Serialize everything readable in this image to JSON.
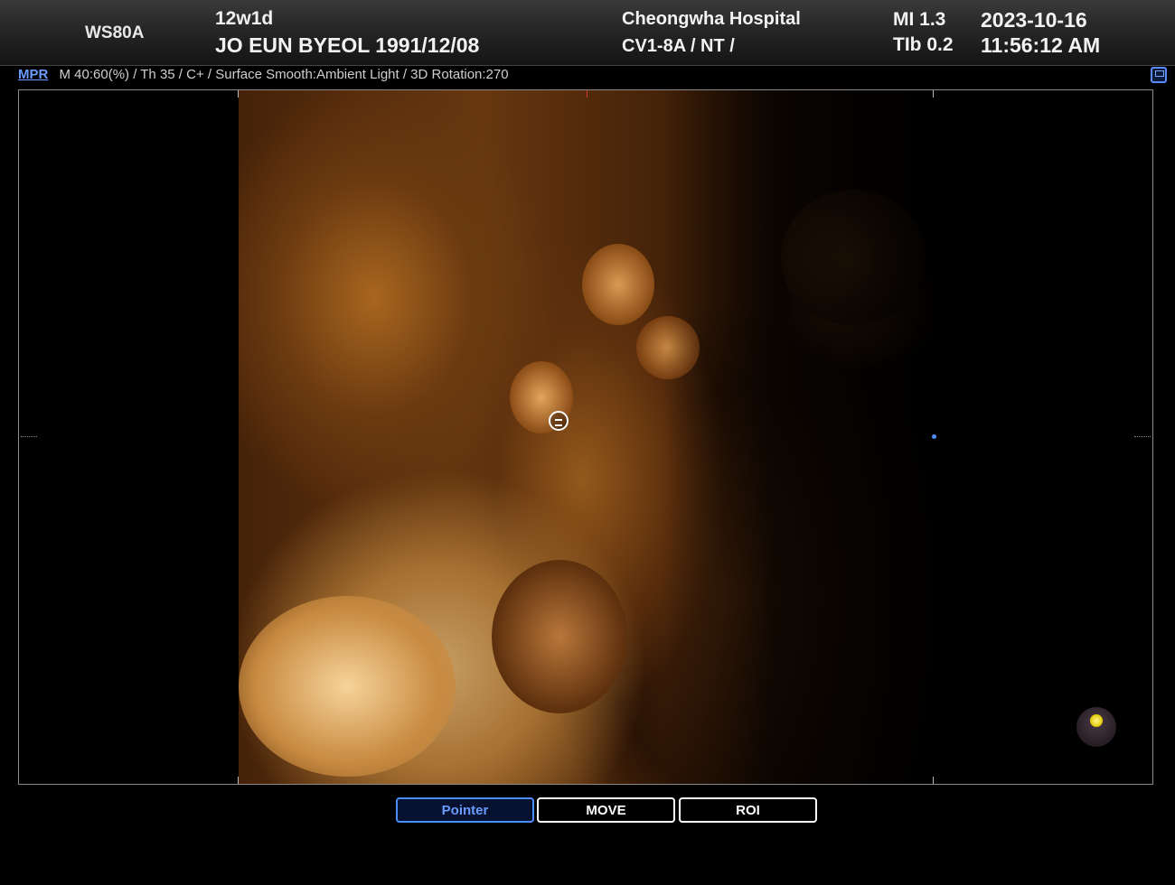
{
  "header": {
    "system_model": "WS80A",
    "gestational_age": "12w1d",
    "patient_info": "JO EUN BYEOL 1991/12/08",
    "hospital": "Cheongwha Hospital",
    "probe_preset": "CV1-8A / NT /",
    "mi": "MI  1.3",
    "tib": "TIb 0.2",
    "date": "2023-10-16",
    "time": "11:56:12 AM"
  },
  "status": {
    "mode_link": "MPR",
    "render_params": "M 40:60(%) / Th 35 / C+ / Surface Smooth:Ambient Light / 3D Rotation:270"
  },
  "controls": {
    "pointer_label": "Pointer",
    "move_label": "MOVE",
    "roi_label": "ROI",
    "active": "Pointer"
  },
  "colors": {
    "accent": "#4c8dff",
    "render_tint": "#c98b3e"
  },
  "icons": {
    "save": "save-icon",
    "cursor": "rotate-cursor-icon",
    "light": "light-source-icon"
  }
}
